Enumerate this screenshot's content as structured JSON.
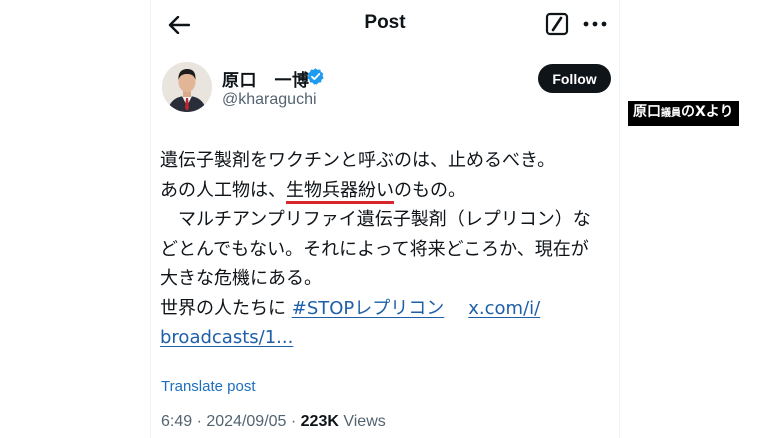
{
  "header": {
    "title": "Post"
  },
  "author": {
    "name": "原口　一博",
    "handle": "@kharaguchi",
    "follow_label": "Follow"
  },
  "caption": {
    "part1": "原口",
    "part2": "議員",
    "part3": "のXより"
  },
  "post": {
    "line1": "遺伝子製剤をワクチンと呼ぶのは、止めるべき。",
    "line2_pre": "あの人工物は、",
    "line2_highlight": "生物兵器紛い",
    "line2_post": "のもの。",
    "line3": "　マルチアンプリファイ遺伝子製剤（レプリコン）な",
    "line4": "どとんでもない。それによって将来どころか、現在が",
    "line5": "大きな危機にある。",
    "line6_pre": "世界の人たちに ",
    "hashtag": "#STOPレプリコン",
    "link1": "x.com/i/",
    "link2": "broadcasts/1..."
  },
  "translate_label": "Translate post",
  "meta": {
    "time": "6:49",
    "sep1": " · ",
    "date": "2024/09/05",
    "sep2": " · ",
    "views_count": "223K",
    "views_label": " Views"
  },
  "icons": {
    "back": "arrow-left-icon",
    "compose": "compose-icon",
    "more": "more-horizontal-icon",
    "verified": "verified-badge-icon"
  },
  "colors": {
    "accent_link": "#1d5fa8",
    "verified": "#1d9bf0",
    "highlight_underline": "#d8262c"
  }
}
